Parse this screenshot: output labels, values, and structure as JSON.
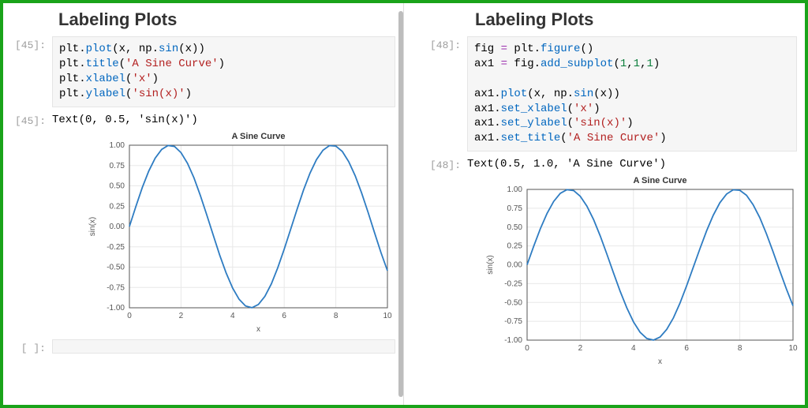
{
  "left": {
    "heading": "Labeling Plots",
    "code_prompt": "[45]:",
    "code_tokens": [
      [
        "plt.",
        "plot",
        "(x, np.",
        "sin",
        "(x))\n"
      ],
      [
        "plt.",
        "title",
        "(",
        "'A Sine Curve'",
        ")\n"
      ],
      [
        "plt.",
        "xlabel",
        "(",
        "'x'",
        ")\n"
      ],
      [
        "plt.",
        "ylabel",
        "(",
        "'sin(x)'",
        ")"
      ]
    ],
    "out_prompt": "[45]:",
    "out_text": "Text(0, 0.5, 'sin(x)')",
    "empty_prompt": "[ ]:"
  },
  "right": {
    "heading": "Labeling Plots",
    "code_prompt": "[48]:",
    "code_tokens": [
      [
        "fig ",
        "=",
        " plt.",
        "figure",
        "()\n"
      ],
      [
        "ax1 ",
        "=",
        " fig.",
        "add_subplot",
        "(",
        "1",
        ",",
        "1",
        ",",
        "1",
        ")\n\n"
      ],
      [
        "ax1.",
        "plot",
        "(x, np.",
        "sin",
        "(x))\n"
      ],
      [
        "ax1.",
        "set_xlabel",
        "(",
        "'x'",
        ")\n"
      ],
      [
        "ax1.",
        "set_ylabel",
        "(",
        "'sin(x)'",
        ")\n"
      ],
      [
        "ax1.",
        "set_title",
        "(",
        "'A Sine Curve'",
        ")"
      ]
    ],
    "out_prompt": "[48]:",
    "out_text": "Text(0.5, 1.0, 'A Sine Curve')"
  },
  "chart_data": {
    "type": "line",
    "title": "A Sine Curve",
    "xlabel": "x",
    "ylabel": "sin(x)",
    "xlim": [
      0,
      10
    ],
    "ylim": [
      -1.0,
      1.0
    ],
    "xticks": [
      0,
      2,
      4,
      6,
      8,
      10
    ],
    "yticks": [
      -1.0,
      -0.75,
      -0.5,
      -0.25,
      0.0,
      0.25,
      0.5,
      0.75,
      1.0
    ],
    "series": [
      {
        "name": "sin(x)",
        "x": [
          0,
          0.25,
          0.5,
          0.75,
          1,
          1.25,
          1.5,
          1.75,
          2,
          2.25,
          2.5,
          2.75,
          3,
          3.25,
          3.5,
          3.75,
          4,
          4.25,
          4.5,
          4.75,
          5,
          5.25,
          5.5,
          5.75,
          6,
          6.25,
          6.5,
          6.75,
          7,
          7.25,
          7.5,
          7.75,
          8,
          8.25,
          8.5,
          8.75,
          9,
          9.25,
          9.5,
          9.75,
          10
        ],
        "y": [
          0.0,
          0.247,
          0.479,
          0.682,
          0.841,
          0.949,
          0.997,
          0.984,
          0.909,
          0.778,
          0.599,
          0.382,
          0.141,
          -0.108,
          -0.351,
          -0.572,
          -0.757,
          -0.895,
          -0.978,
          -0.999,
          -0.959,
          -0.859,
          -0.706,
          -0.508,
          -0.279,
          -0.033,
          0.215,
          0.45,
          0.657,
          0.823,
          0.938,
          0.995,
          0.989,
          0.923,
          0.798,
          0.625,
          0.412,
          0.174,
          -0.075,
          -0.32,
          -0.544
        ]
      }
    ]
  }
}
